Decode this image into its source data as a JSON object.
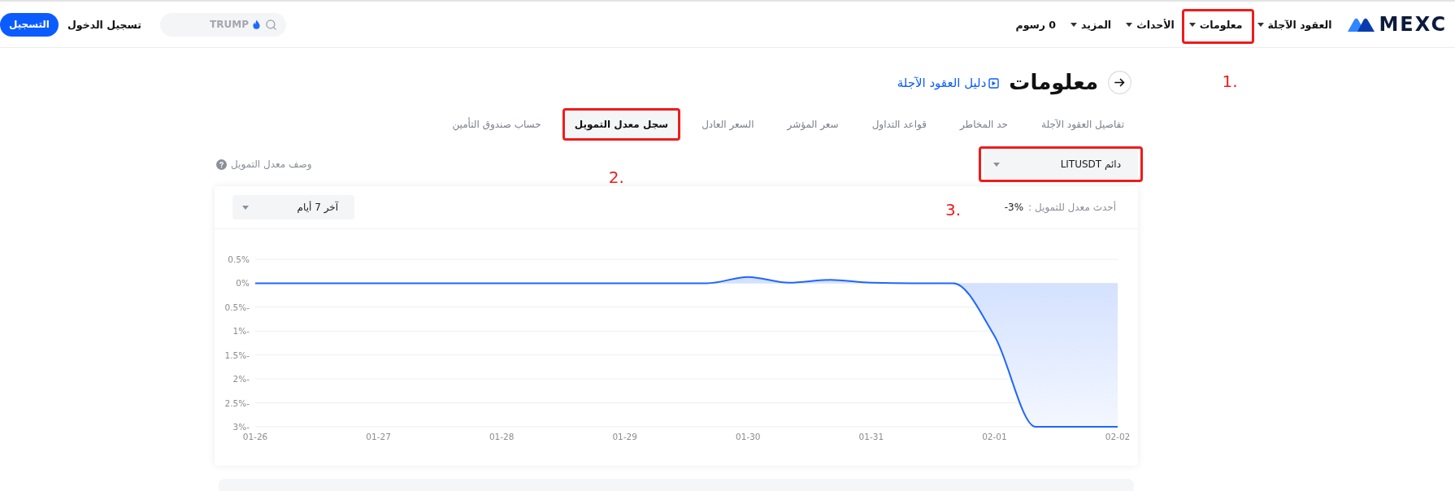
{
  "header": {
    "logo": "MEXC",
    "nav": [
      {
        "label": "العقود الآجلة",
        "dropdown": true,
        "highlighted": false
      },
      {
        "label": "معلومات",
        "dropdown": true,
        "highlighted": true,
        "annotation": "1."
      },
      {
        "label": "الأحداث",
        "dropdown": true,
        "highlighted": false
      },
      {
        "label": "المزيد",
        "dropdown": true,
        "highlighted": false
      },
      {
        "label": "0 رسوم",
        "dropdown": false,
        "highlighted": false
      }
    ],
    "search": {
      "placeholder": "TRUMP"
    },
    "login": "تسجيل الدخول",
    "register": "التسجيل"
  },
  "page": {
    "title": "معلومات",
    "guide_link": "دليل العقود الآجلة"
  },
  "tabs": [
    {
      "label": "تفاصيل العقود الآجلة",
      "selected": false,
      "highlighted": false
    },
    {
      "label": "حد المخاطر",
      "selected": false,
      "highlighted": false
    },
    {
      "label": "قواعد التداول",
      "selected": false,
      "highlighted": false
    },
    {
      "label": "سعر المؤشر",
      "selected": false,
      "highlighted": false
    },
    {
      "label": "السعر العادل",
      "selected": false,
      "highlighted": false
    },
    {
      "label": "سجل معدل التمويل",
      "selected": true,
      "highlighted": true,
      "annotation": "2."
    },
    {
      "label": "حساب صندوق التأمين",
      "selected": false,
      "highlighted": false
    }
  ],
  "pair_select": {
    "value": "دائم LITUSDT",
    "highlighted": true,
    "annotation": "3."
  },
  "funding_description": "وصف معدل التمويل",
  "chart_card": {
    "period_select": {
      "value": "آخر 7 أيام"
    },
    "latest_rate_label": "أحدث معدل للتمويل :",
    "latest_rate_value": "-3%",
    "chart_data": {
      "type": "area",
      "grid": true,
      "categories": [
        "01-26",
        null,
        null,
        "01-27",
        null,
        null,
        "01-28",
        null,
        null,
        "01-29",
        null,
        null,
        "01-30",
        null,
        null,
        "01-31",
        null,
        null,
        "02-01",
        null,
        null,
        "02-02"
      ],
      "ylim": [
        -3,
        0.5
      ],
      "yticks": [
        {
          "value": 0.5,
          "label": "0.5%"
        },
        {
          "value": 0,
          "label": "0%"
        },
        {
          "value": -0.5,
          "label": "-0.5%"
        },
        {
          "value": -1,
          "label": "-1%"
        },
        {
          "value": -1.5,
          "label": "-1.5%"
        },
        {
          "value": -2,
          "label": "-2%"
        },
        {
          "value": -2.5,
          "label": "-2.5%"
        },
        {
          "value": -3,
          "label": "-3%"
        }
      ],
      "values": [
        0,
        0,
        0,
        0,
        0,
        0,
        0,
        0,
        0,
        0,
        0,
        0,
        0.13,
        0.01,
        0.07,
        0.01,
        0,
        0,
        -1.1,
        -3,
        -3,
        -3
      ]
    }
  }
}
